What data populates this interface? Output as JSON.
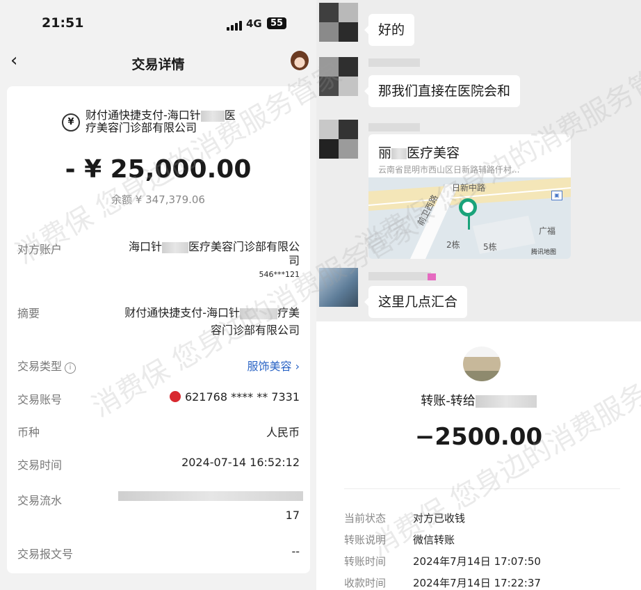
{
  "left": {
    "status": {
      "time": "21:51",
      "network": "4G",
      "battery": "55"
    },
    "header": {
      "back_icon": "chevron-left-icon",
      "title": "交易详情"
    },
    "merchant": {
      "icon": "yuan-refund-icon",
      "line1": "财付通快捷支付-海口针",
      "line1_end": "医",
      "line2": "疗美容门诊部有限公司"
    },
    "amount": "- ¥ 25,000.00",
    "balance": "余额 ¥ 347,379.06",
    "rows": {
      "counterparty": {
        "label": "对方账户",
        "value_a": "海口针",
        "value_b": "医疗美容门诊部有限公",
        "value_c": "司",
        "account": "546***121"
      },
      "summary": {
        "label": "摘要",
        "value_a": "财付通快捷支付-海口针",
        "value_b": "疗美",
        "value_c": "容门诊部有限公司"
      },
      "type": {
        "label": "交易类型",
        "info_icon": "ⓘ",
        "value": "服饰美容",
        "chevron": "›"
      },
      "account": {
        "label": "交易账号",
        "value": "621768 **** ** 7331"
      },
      "currency": {
        "label": "币种",
        "value": "人民币"
      },
      "time": {
        "label": "交易时间",
        "value": "2024-07-14 16:52:12"
      },
      "serial": {
        "label": "交易流水",
        "value_tail": "17"
      },
      "message_no": {
        "label": "交易报文号",
        "value": "--"
      }
    }
  },
  "chat": {
    "messages": [
      {
        "text": "好的"
      },
      {
        "text": "那我们直接在医院会和"
      },
      {
        "type": "location",
        "title_a": "丽",
        "title_b": "医疗美容",
        "address": "云南省昆明市西山区日新路辅路仟村...",
        "map_labels": {
          "road1": "日新中路",
          "road2": "前卫西路",
          "bld1": "2栋",
          "bld2": "5栋",
          "poi": "广福",
          "brand": "腾讯地图"
        }
      },
      {
        "text": "这里几点汇合"
      }
    ]
  },
  "transfer": {
    "title": "转账-转给",
    "amount": "−2500.00",
    "rows": [
      {
        "label": "当前状态",
        "value": "对方已收钱"
      },
      {
        "label": "转账说明",
        "value": "微信转账"
      },
      {
        "label": "转账时间",
        "value": "2024年7月14日 17:07:50"
      },
      {
        "label": "收款时间",
        "value": "2024年7月14日 17:22:37"
      }
    ]
  },
  "watermark": "消费保 您身边的消费服务管家",
  "colors": {
    "link": "#2a64c5",
    "bank": "#d8282f",
    "pin": "#1aa37a"
  }
}
